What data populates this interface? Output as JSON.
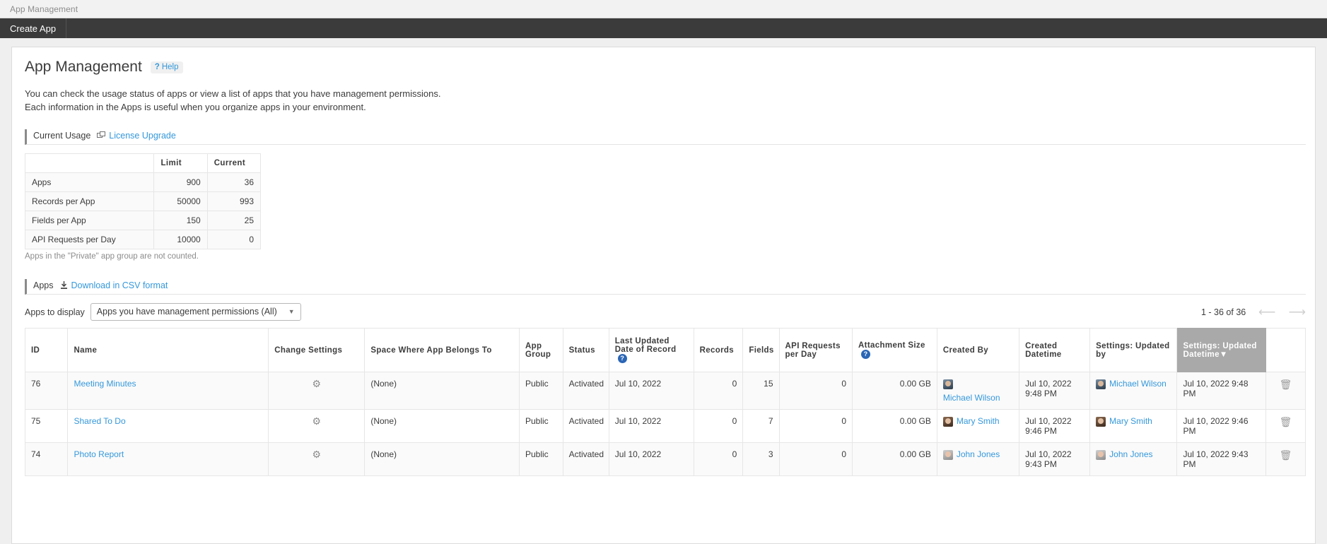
{
  "topbar": {
    "title": "App Management"
  },
  "nav": {
    "items": [
      {
        "label": "Create App"
      }
    ]
  },
  "header": {
    "title": "App Management",
    "help_label": "Help",
    "help_icon": "question-mark-icon",
    "description_line1": "You can check the usage status of apps or view a list of apps that you have management permissions.",
    "description_line2": "Each information in the Apps is useful when you organize apps in your environment."
  },
  "current_usage": {
    "section_label": "Current Usage",
    "license_link": "License Upgrade",
    "license_icon": "external-window-icon",
    "columns": [
      "",
      "Limit",
      "Current"
    ],
    "rows": [
      {
        "label": "Apps",
        "limit": "900",
        "current": "36"
      },
      {
        "label": "Records per App",
        "limit": "50000",
        "current": "993"
      },
      {
        "label": "Fields per App",
        "limit": "150",
        "current": "25"
      },
      {
        "label": "API Requests per Day",
        "limit": "10000",
        "current": "0"
      }
    ],
    "note": "Apps in the \"Private\" app group are not counted."
  },
  "apps_section": {
    "section_label": "Apps",
    "csv_link": "Download in CSV format",
    "csv_icon": "download-icon",
    "display_label": "Apps to display",
    "display_value": "Apps you have management permissions (All)",
    "display_options": [
      "Apps you have management permissions (All)"
    ],
    "pager_text": "1 - 36 of 36",
    "prev_icon": "arrow-left-icon",
    "next_icon": "arrow-right-icon",
    "columns": [
      "ID",
      "Name",
      "Change Settings",
      "Space Where App Belongs To",
      "App Group",
      "Status",
      "Last Updated Date of Record",
      "Records",
      "Fields",
      "API Requests per Day",
      "Attachment Size",
      "Created By",
      "Created Datetime",
      "Settings: Updated by",
      "Settings: Updated Datetime",
      ""
    ],
    "sorted_column": "Settings: Updated Datetime",
    "sort_indicator": "▼",
    "rows": [
      {
        "id": "76",
        "name": "Meeting Minutes",
        "change_settings_icon": "gear-icon",
        "space": "(None)",
        "app_group": "Public",
        "status": "Activated",
        "last_updated_record": "Jul 10, 2022",
        "records": "0",
        "fields": "15",
        "api_requests": "0",
        "attachment_size": "0.00 GB",
        "created_by": "Michael Wilson",
        "created_datetime": "Jul 10, 2022 9:48 PM",
        "updated_by": "Michael Wilson",
        "updated_datetime": "Jul 10, 2022 9:48 PM",
        "delete_icon": "trash-icon"
      },
      {
        "id": "75",
        "name": "Shared To Do",
        "change_settings_icon": "gear-icon",
        "space": "(None)",
        "app_group": "Public",
        "status": "Activated",
        "last_updated_record": "Jul 10, 2022",
        "records": "0",
        "fields": "7",
        "api_requests": "0",
        "attachment_size": "0.00 GB",
        "created_by": "Mary Smith",
        "created_datetime": "Jul 10, 2022 9:46 PM",
        "updated_by": "Mary Smith",
        "updated_datetime": "Jul 10, 2022 9:46 PM",
        "delete_icon": "trash-icon"
      },
      {
        "id": "74",
        "name": "Photo Report",
        "change_settings_icon": "gear-icon",
        "space": "(None)",
        "app_group": "Public",
        "status": "Activated",
        "last_updated_record": "Jul 10, 2022",
        "records": "0",
        "fields": "3",
        "api_requests": "0",
        "attachment_size": "0.00 GB",
        "created_by": "John Jones",
        "created_datetime": "Jul 10, 2022 9:43 PM",
        "updated_by": "John Jones",
        "updated_datetime": "Jul 10, 2022 9:43 PM",
        "delete_icon": "trash-icon"
      }
    ]
  },
  "colors": {
    "link": "#3498db",
    "navbar": "#3b3b3b",
    "sorted_header": "#a9a9a9",
    "help_badge": "#2b66b5"
  }
}
